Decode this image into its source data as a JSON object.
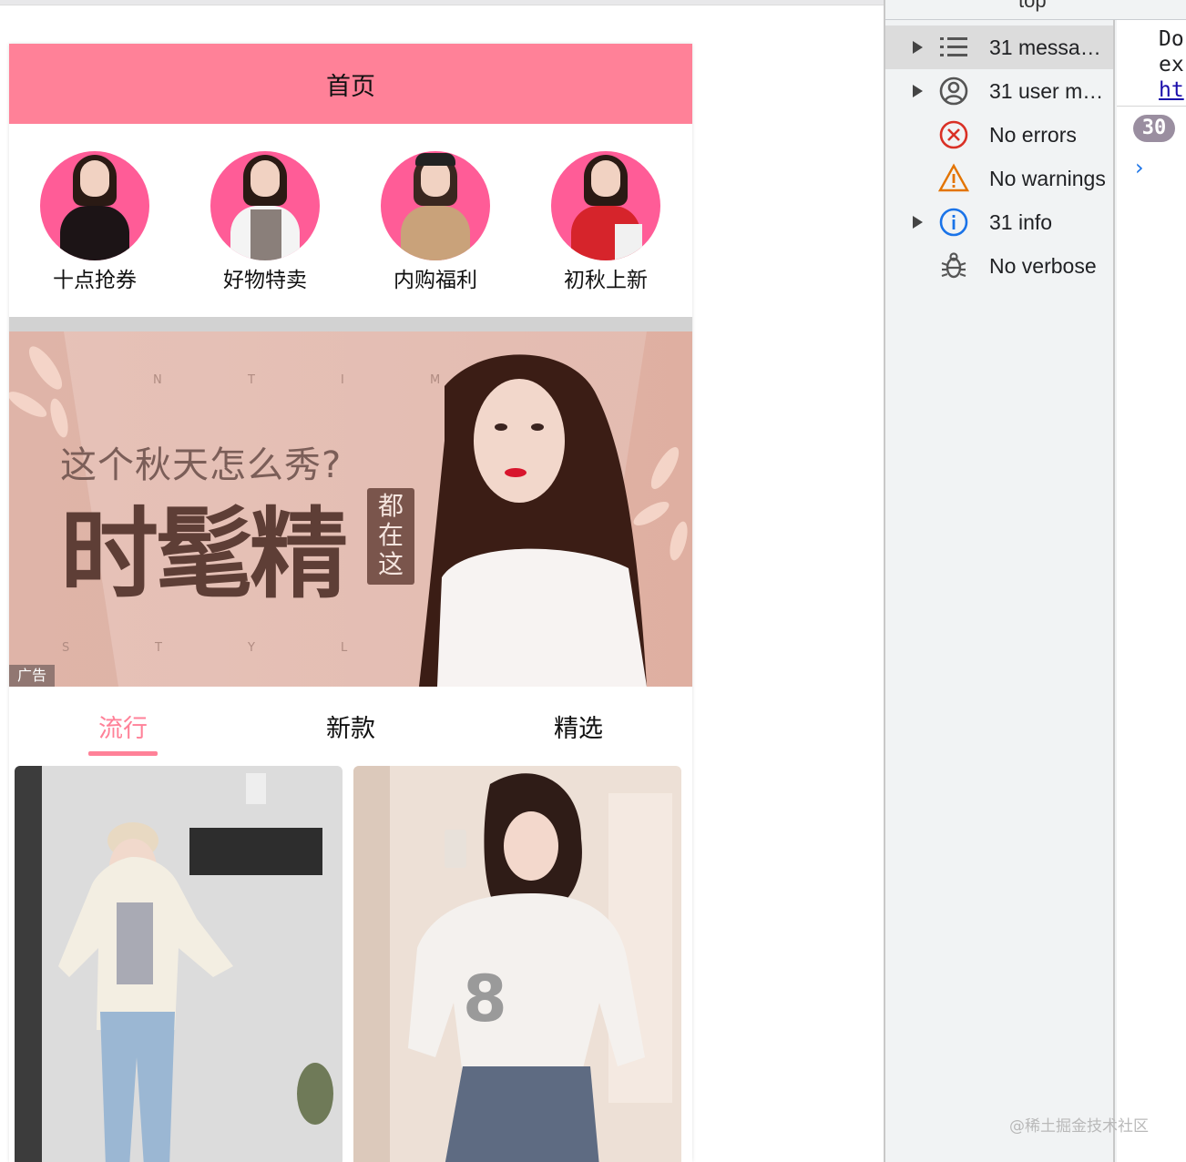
{
  "app": {
    "nav_title": "首页",
    "recommends": [
      {
        "label": "十点抢券"
      },
      {
        "label": "好物特卖"
      },
      {
        "label": "内购福利"
      },
      {
        "label": "初秋上新"
      }
    ],
    "banner": {
      "headline": "这个秋天怎么秀?",
      "big_text": "时髦精",
      "side_text": [
        "都",
        "在",
        "这"
      ],
      "letters_top": [
        "N",
        "T",
        "I",
        "M"
      ],
      "letters_bottom": [
        "S",
        "T",
        "Y",
        "L"
      ],
      "ad_label": "广告"
    },
    "tabs": [
      {
        "label": "流行",
        "active": true
      },
      {
        "label": "新款",
        "active": false
      },
      {
        "label": "精选",
        "active": false
      }
    ],
    "accent_color": "#ff8198"
  },
  "devtools": {
    "filters": [
      {
        "label": "31 messa…",
        "icon": "list-icon",
        "expandable": true,
        "selected": true
      },
      {
        "label": "31 user m…",
        "icon": "user-icon",
        "expandable": true,
        "selected": false
      },
      {
        "label": "No errors",
        "icon": "error-icon",
        "expandable": false,
        "selected": false
      },
      {
        "label": "No warnings",
        "icon": "warning-icon",
        "expandable": false,
        "selected": false
      },
      {
        "label": "31 info",
        "icon": "info-icon",
        "expandable": true,
        "selected": false
      },
      {
        "label": "No verbose",
        "icon": "bug-icon",
        "expandable": false,
        "selected": false
      }
    ],
    "console_lines": [
      "Do",
      "ex",
      "ht"
    ],
    "badge_count": "30",
    "toolbar_context": "top",
    "prompt": "›"
  },
  "watermark": "@稀土掘金技术社区"
}
